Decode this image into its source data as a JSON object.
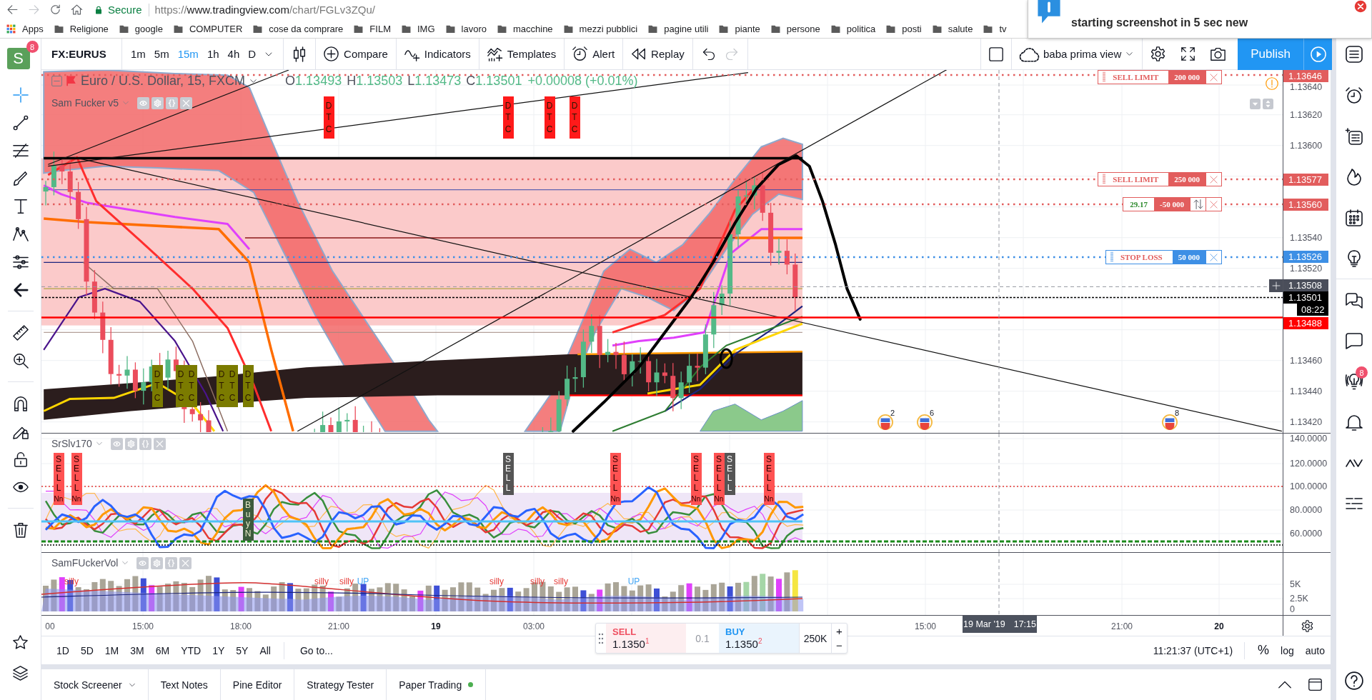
{
  "browser": {
    "nav": [
      {
        "kind": "back",
        "disabled": false
      },
      {
        "kind": "forward",
        "disabled": true
      },
      {
        "kind": "reload",
        "disabled": false
      },
      {
        "kind": "home",
        "disabled": false
      }
    ],
    "security": "Secure",
    "url": {
      "scheme": "https://",
      "host": "www.tradingview.com",
      "path": "/chart/FGLv3ZQu/"
    }
  },
  "bookmarks": [
    {
      "label": "Apps",
      "kind": "apps"
    },
    {
      "label": "Religione",
      "kind": "folder"
    },
    {
      "label": "google",
      "kind": "folder"
    },
    {
      "label": "COMPUTER",
      "kind": "folder"
    },
    {
      "label": "cose da comprare",
      "kind": "folder"
    },
    {
      "label": "FILM",
      "kind": "folder"
    },
    {
      "label": "IMG",
      "kind": "folder"
    },
    {
      "label": "lavoro",
      "kind": "folder"
    },
    {
      "label": "macchine",
      "kind": "folder"
    },
    {
      "label": "mezzi pubblici",
      "kind": "folder"
    },
    {
      "label": "pagine utili",
      "kind": "folder"
    },
    {
      "label": "piante",
      "kind": "folder"
    },
    {
      "label": "persone",
      "kind": "folder"
    },
    {
      "label": "politica",
      "kind": "folder"
    },
    {
      "label": "posti",
      "kind": "folder"
    },
    {
      "label": "salute",
      "kind": "folder"
    },
    {
      "label": "tv",
      "kind": "folder"
    }
  ],
  "notification": {
    "text": "starting screenshot in 5 sec new"
  },
  "profile": {
    "initial": "S",
    "badge": "8"
  },
  "toolbar": {
    "symbol": "FX:EURUS",
    "intervals": [
      {
        "label": "1m",
        "selected": false
      },
      {
        "label": "5m",
        "selected": false
      },
      {
        "label": "15m",
        "selected": true
      },
      {
        "label": "1h",
        "selected": false
      },
      {
        "label": "4h",
        "selected": false
      },
      {
        "label": "D",
        "selected": false
      }
    ],
    "actions": [
      {
        "label": "Compare",
        "kind": "compare"
      },
      {
        "label": "Indicators",
        "kind": "indicators"
      },
      {
        "label": "Templates",
        "kind": "templates"
      },
      {
        "label": "Alert",
        "kind": "alert"
      },
      {
        "label": "Replay",
        "kind": "replay"
      }
    ],
    "history": [
      {
        "kind": "undo",
        "disabled": false
      },
      {
        "kind": "redo",
        "disabled": true
      }
    ],
    "layout": "baba prima view",
    "publish": "Publish"
  },
  "legend": {
    "title": "Euro / U.S. Dollar, 15, FXCM",
    "rising": true,
    "ohlc": [
      {
        "key": "O",
        "value": "1.13493"
      },
      {
        "key": "H",
        "value": "1.13503"
      },
      {
        "key": "L",
        "value": "1.13473"
      },
      {
        "key": "C",
        "value": "1.13501"
      }
    ],
    "change": "+0.00008 (+0.01%)"
  },
  "main_pane": {
    "indicator": "Sam Fucker v5",
    "price_ticks": [
      "1.13640",
      "1.13620",
      "1.13600",
      "1.13540",
      "1.13520",
      "1.13460",
      "1.13440",
      "1.13420"
    ],
    "price_tags": [
      {
        "kind": "sell",
        "text": "1.13646"
      },
      {
        "kind": "sell",
        "text": "1.13577"
      },
      {
        "kind": "sell",
        "text": "1.13560"
      },
      {
        "kind": "stop",
        "text": "1.13526"
      },
      {
        "kind": "crosshair",
        "text": "1.13508"
      },
      {
        "kind": "last",
        "text": "1.13501"
      },
      {
        "kind": "countdown",
        "text": "08:22"
      },
      {
        "kind": "alert",
        "text": "1.13488"
      }
    ],
    "orders": [
      {
        "kind": "sell_limit",
        "label": "SELL LIMIT",
        "quantity": "200 000"
      },
      {
        "kind": "sell_limit",
        "label": "SELL LIMIT",
        "quantity": "250 000"
      },
      {
        "kind": "position",
        "profit": "29.17",
        "quantity": "-50 000"
      },
      {
        "kind": "stop_loss",
        "label": "STOP LOSS",
        "quantity": "50 000"
      }
    ],
    "signals": [
      {
        "text": "DTC",
        "color": "#7b7b00"
      },
      {
        "text": "DTC",
        "color": "#7b7b00"
      },
      {
        "text": "DTC",
        "color": "#7b7b00"
      },
      {
        "text": "DTC",
        "color": "#7b7b00"
      },
      {
        "text": "DTC",
        "color": "#7b7b00"
      },
      {
        "text": "DTC",
        "color": "#7b7b00"
      },
      {
        "text": "DTC",
        "color": "#ff1a1a"
      },
      {
        "text": "DTC",
        "color": "#ff1a1a"
      },
      {
        "text": "DTC",
        "color": "#ff1a1a"
      },
      {
        "text": "DTC",
        "color": "#ff1a1a"
      }
    ],
    "events": [
      {
        "count": "2"
      },
      {
        "count": "6"
      },
      {
        "count": "8"
      }
    ]
  },
  "oscillator_pane": {
    "indicator": "SrSlv170",
    "ticks": [
      "140.0000",
      "120.0000",
      "100.0000",
      "80.0000",
      "60.0000"
    ],
    "signals": [
      {
        "kind": "sell",
        "text": "SELL",
        "note": "Nn"
      },
      {
        "kind": "sell",
        "text": "SELL",
        "note": "Nn"
      },
      {
        "kind": "buy",
        "text": "BuyN"
      },
      {
        "kind": "sell_dark",
        "text": "SELL"
      },
      {
        "kind": "sell",
        "text": "SELL",
        "note": "Nn"
      },
      {
        "kind": "sell",
        "text": "SELL",
        "note": "Nn"
      },
      {
        "kind": "sell",
        "text": "SELL",
        "note": "Nn"
      },
      {
        "kind": "sell_dark",
        "text": "SELL"
      },
      {
        "kind": "sell",
        "text": "SELL",
        "note": "Nn"
      }
    ]
  },
  "volume_pane": {
    "indicator": "SamFUckerVol",
    "ticks": [
      "5K",
      "2.5K",
      "0"
    ],
    "signals": [
      {
        "kind": "silly",
        "text": "silly"
      },
      {
        "kind": "silly",
        "text": "silly"
      },
      {
        "kind": "silly",
        "text": "silly"
      },
      {
        "kind": "up",
        "text": "UP"
      },
      {
        "kind": "silly",
        "text": "silly"
      },
      {
        "kind": "silly",
        "text": "silly"
      },
      {
        "kind": "silly",
        "text": "silly"
      },
      {
        "kind": "up",
        "text": "UP"
      }
    ]
  },
  "time_axis": {
    "labels": [
      {
        "text": "00",
        "bold": false
      },
      {
        "text": "15:00",
        "bold": false
      },
      {
        "text": "18:00",
        "bold": false
      },
      {
        "text": "21:00",
        "bold": false
      },
      {
        "text": "19",
        "bold": true
      },
      {
        "text": "03:00",
        "bold": false
      },
      {
        "text": "15:00",
        "bold": false
      },
      {
        "text": "21:00",
        "bold": false
      },
      {
        "text": "20",
        "bold": true
      }
    ],
    "crosshair": {
      "date": "19 Mar '19",
      "time": "17:15"
    }
  },
  "order_panel": {
    "sell": {
      "label": "SELL",
      "price": "1.1350$^{1}$"
    },
    "spread": "0.1",
    "buy": {
      "label": "BUY",
      "price": "1.1350$^{2}$"
    },
    "quantity": "250K",
    "steppers": [
      "+",
      "−"
    ]
  },
  "bottom_toolbar": {
    "ranges": [
      "1D",
      "5D",
      "1M",
      "3M",
      "6M",
      "YTD",
      "1Y",
      "5Y",
      "All"
    ],
    "goto": "Go to...",
    "clock": "11:21:37 (UTC+1)",
    "scales": [
      "%",
      "log",
      "auto"
    ]
  },
  "bottom_tabs": [
    {
      "label": "Stock Screener",
      "kind": "dropdown"
    },
    {
      "label": "Text Notes",
      "kind": "plain"
    },
    {
      "label": "Pine Editor",
      "kind": "plain"
    },
    {
      "label": "Strategy Tester",
      "kind": "plain"
    },
    {
      "label": "Paper Trading",
      "kind": "status"
    }
  ],
  "right_sidebar": {
    "badge": "8"
  }
}
